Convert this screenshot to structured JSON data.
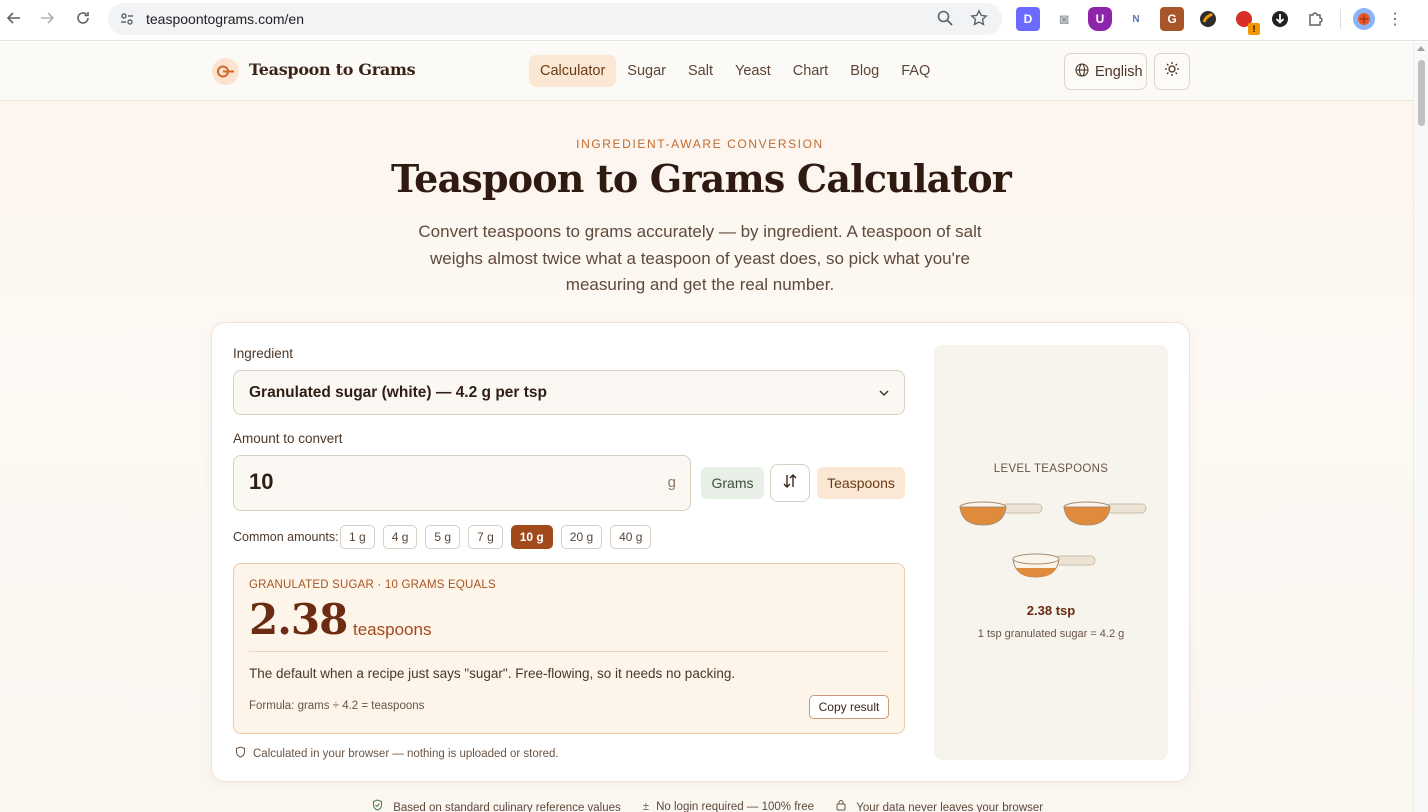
{
  "browser": {
    "url": "teaspoontograms.com/en",
    "extensions": [
      {
        "name": "d-extension-icon",
        "color": "#6b6bff",
        "glyph": "D"
      },
      {
        "name": "camera-extension-icon",
        "color": "#9aa0a6",
        "glyph": "◙"
      },
      {
        "name": "ublock-extension-icon",
        "color": "#8e24aa",
        "glyph": "U"
      },
      {
        "name": "news-extension-icon",
        "color": "#5a78b0",
        "glyph": "N"
      },
      {
        "name": "g-extension-icon",
        "color": "#a9552a",
        "glyph": "G"
      },
      {
        "name": "swirl-extension-icon",
        "color": "#2c2c2c",
        "glyph": "S"
      },
      {
        "name": "warning-extension-icon",
        "color": "#d93025",
        "glyph": "●"
      },
      {
        "name": "download-extension-icon",
        "color": "#202124",
        "glyph": "↓"
      }
    ]
  },
  "header": {
    "logo": "Teaspoon to Grams",
    "nav": [
      "Calculator",
      "Sugar",
      "Salt",
      "Yeast",
      "Chart",
      "Blog",
      "FAQ"
    ],
    "active_nav": "Calculator",
    "language": "English"
  },
  "hero": {
    "eyebrow": "INGREDIENT-AWARE CONVERSION",
    "title": "Teaspoon to Grams Calculator",
    "lede": "Convert teaspoons to grams accurately — by ingredient. A teaspoon of salt weighs almost twice what a teaspoon of yeast does, so pick what you're measuring and get the real number."
  },
  "calculator": {
    "ingredient_label": "Ingredient",
    "ingredient_value": "Granulated sugar (white) — 4.2 g per tsp",
    "amount_label": "Amount to convert",
    "amount_value": "10",
    "amount_unit": "g",
    "from_unit": "Grams",
    "to_unit": "Teaspoons",
    "common_label": "Common amounts:",
    "common_amounts": [
      "1 g",
      "4 g",
      "5 g",
      "7 g",
      "10 g",
      "20 g",
      "40 g"
    ],
    "active_amount": "10 g",
    "result": {
      "eyebrow": "GRANULATED SUGAR · 10 GRAMS EQUALS",
      "value": "2.38",
      "unit": "teaspoons",
      "description": "The default when a recipe just says \"sugar\". Free-flowing, so it needs no packing.",
      "formula": "Formula: grams ÷ 4.2 = teaspoons",
      "copy_label": "Copy result"
    },
    "privacy": "Calculated in your browser — nothing is uploaded or stored."
  },
  "visual": {
    "title": "LEVEL TEASPOONS",
    "value": "2.38 tsp",
    "note": "1 tsp granulated sugar = 4.2 g",
    "fill_levels": [
      1,
      1,
      0.38
    ],
    "spoon_color": "#e08a3c"
  },
  "trust": [
    "Based on standard culinary reference values",
    "No login required — 100% free",
    "Your data never leaves your browser"
  ],
  "colors": {
    "accent": "#a34a1d",
    "brand_text": "#3b2417",
    "eyebrow": "#c26a2c"
  }
}
